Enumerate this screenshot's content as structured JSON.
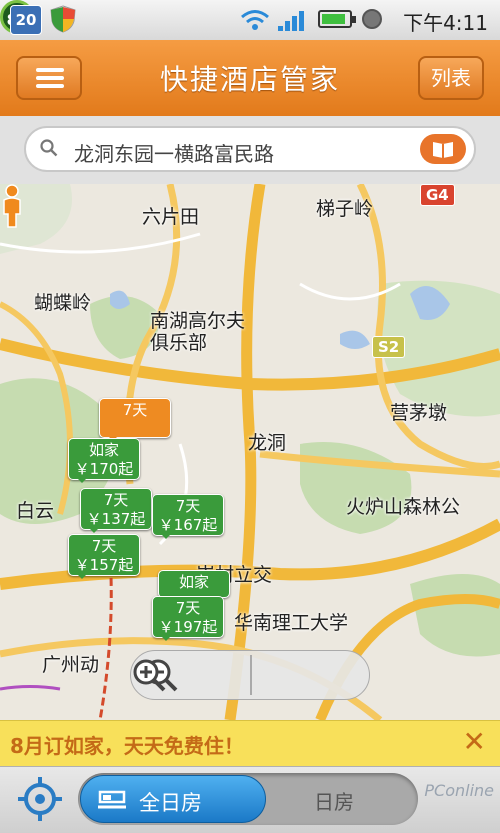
{
  "status_bar": {
    "badge": "20",
    "circle_badge": "81",
    "time": "下午4:11",
    "battery_level": 0.9
  },
  "header": {
    "title": "快捷酒店管家",
    "list_label": "列表"
  },
  "search": {
    "value": "龙洞东园一横路富民路"
  },
  "map": {
    "place_labels": [
      "六片田",
      "梯子岭",
      "蝴蝶岭",
      "南湖高尔夫俱乐部",
      "营茅墩",
      "龙洞",
      "火炉山森林公",
      "白云",
      "华南理工大学",
      "广州动",
      "岑村立交"
    ],
    "road_shields": [
      "G4",
      "S2"
    ],
    "hotel_markers": [
      {
        "brand": "7天",
        "price": ""
      },
      {
        "brand": "如家",
        "price": "￥170起"
      },
      {
        "brand": "7天",
        "price": "￥137起"
      },
      {
        "brand": "7天",
        "price": "￥167起"
      },
      {
        "brand": "7天",
        "price": "￥157起"
      },
      {
        "brand": "如家",
        "price": ""
      },
      {
        "brand": "7天",
        "price": "￥197起"
      }
    ]
  },
  "promo": {
    "text": "8月订如家，天天免费住！",
    "close_symbol": "✕"
  },
  "bottom": {
    "tab_full_day": "全日房",
    "tab_day_room": "日房",
    "watermark": "PConline"
  },
  "colors": {
    "header_orange": "#e8842a",
    "marker_green": "#3a9b3b",
    "marker_orange": "#ee8b22",
    "promo_yellow": "#f8e05a",
    "tab_blue": "#2a8ad8"
  }
}
